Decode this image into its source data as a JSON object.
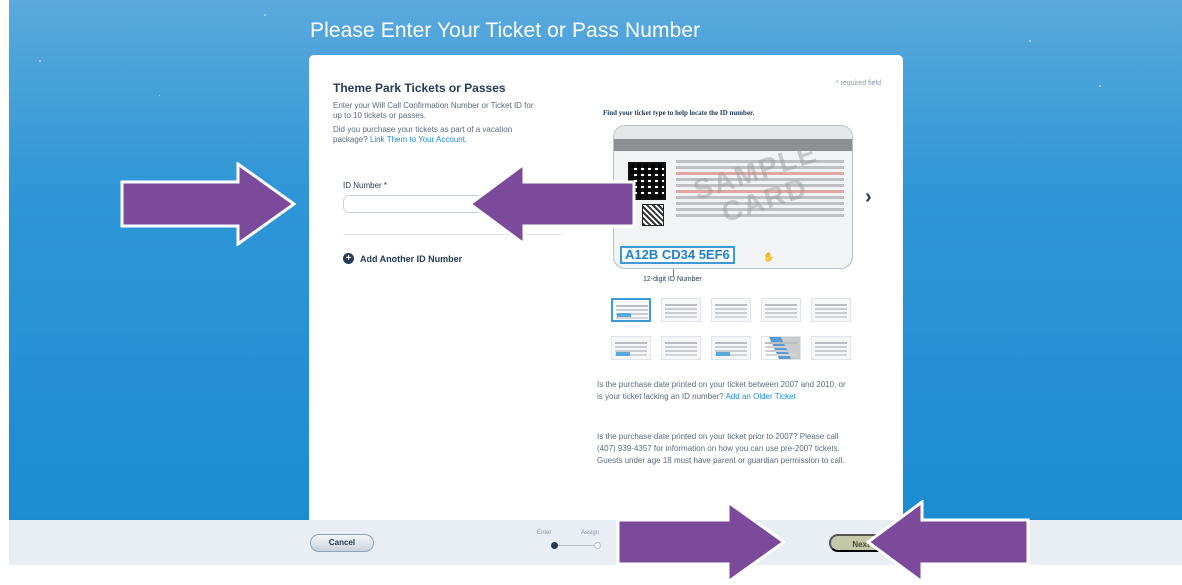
{
  "page": {
    "title": "Please Enter Your Ticket or Pass Number"
  },
  "form": {
    "section_title": "Theme Park Tickets or Passes",
    "required_note": "* required field",
    "intro_line1": "Enter your Will Call Confirmation Number or Ticket ID for up to 10 tickets or passes.",
    "intro_line2": "Did you purchase your tickets as part of a vacation package?",
    "link_account": "Link Them to Your Account.",
    "id_label": "ID Number *",
    "id_value": "",
    "add_another": "Add Another ID Number"
  },
  "help": {
    "find_title": "Find your ticket type to help locate the ID number.",
    "sample_id": "A12B CD34 5EF6",
    "watermark": "SAMPLE CARD",
    "callout_label": "12-digit ID Number",
    "thumbnail_count": 10,
    "selected_thumbnail": 1,
    "info1_text": "Is the purchase date printed on your ticket between 2007 and 2010, or is your ticket lacking an ID number?",
    "info1_link": "Add an Older Ticket",
    "info2_text": "Is the purchase date printed on your ticket prior to 2007? Please call (407) 939-4357 for information on how you can use pre-2007 tickets. Guests under age 18 must have parent or guardian permission to call."
  },
  "footer": {
    "cancel_label": "Cancel",
    "steps": [
      "Enter",
      "Assign"
    ],
    "current_step": 1,
    "next_label": "Next"
  },
  "overlay": {
    "arrow_color": "#7b4a9a",
    "arrow_count": 4
  },
  "colors": {
    "brand_navy": "#253b56",
    "link_blue": "#1e8ad8",
    "background_blue": "#2e96d6"
  }
}
